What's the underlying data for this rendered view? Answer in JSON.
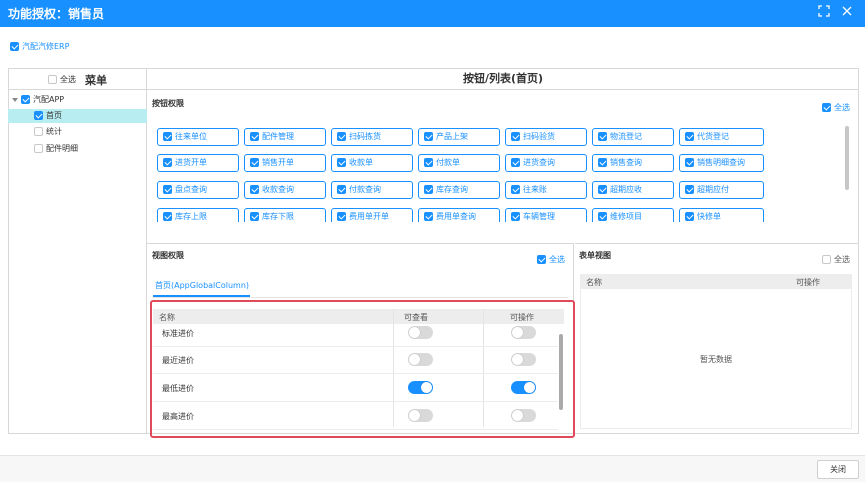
{
  "window": {
    "title": "功能授权：销售员"
  },
  "top": {
    "erp_label": "汽配汽修ERP"
  },
  "menu": {
    "select_all": "全选",
    "title": "菜单",
    "tree": [
      {
        "label": "汽配APP",
        "checked": true,
        "selected": false
      },
      {
        "label": "首页",
        "checked": true,
        "selected": true
      },
      {
        "label": "统计",
        "checked": false,
        "selected": false
      },
      {
        "label": "配件明细",
        "checked": false,
        "selected": false
      }
    ]
  },
  "buttons_section": {
    "header": "按钮/列表(首页)",
    "label": "按钮权限",
    "select_all": "全选",
    "items": [
      "往来单位",
      "配件管理",
      "扫码拣货",
      "产品上架",
      "扫码验货",
      "物流登记",
      "代货登记",
      "进货开单",
      "销售开单",
      "收款单",
      "付款单",
      "进货查询",
      "销售查询",
      "销售明细查询",
      "盘点查询",
      "收款查询",
      "付款查询",
      "库存查询",
      "往来账",
      "超期应收",
      "超期应付",
      "库存上限",
      "库存下限",
      "费用单开单",
      "费用单查询",
      "车辆管理",
      "维修项目",
      "快修单"
    ]
  },
  "view_section": {
    "label": "视图权限",
    "select_all": "全选",
    "tab": "首页(AppGlobalColumn)",
    "columns": {
      "name": "名称",
      "view": "可查看",
      "operate": "可操作"
    },
    "rows": [
      {
        "name": "标准进价",
        "view": false,
        "operate": false
      },
      {
        "name": "最近进价",
        "view": false,
        "operate": false
      },
      {
        "name": "最低进价",
        "view": true,
        "operate": true
      },
      {
        "name": "最高进价",
        "view": false,
        "operate": false
      }
    ]
  },
  "form_section": {
    "label": "表单视图",
    "select_all": "全选",
    "columns": {
      "name": "名称",
      "operate": "可操作"
    },
    "empty": "暂无数据"
  },
  "footer": {
    "close": "关闭"
  },
  "colors": {
    "primary": "#1890ff",
    "highlight": "#e04a5a",
    "selected_row": "#b8eef2"
  }
}
